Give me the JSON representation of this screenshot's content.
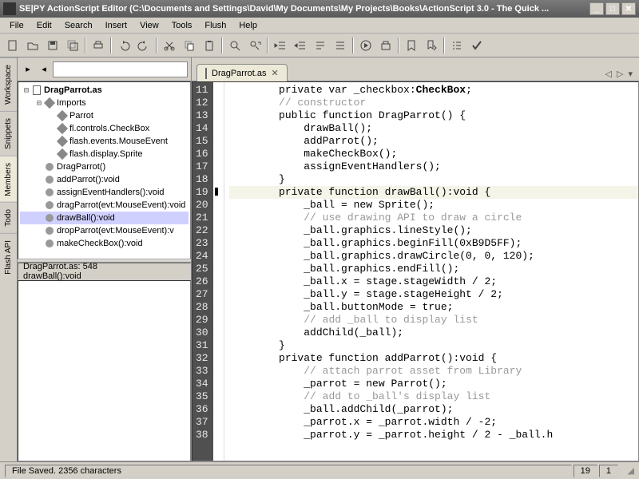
{
  "window": {
    "title": "SE|PY ActionScript Editor (C:\\Documents and Settings\\David\\My Documents\\My Projects\\Books\\ActionScript 3.0 - The Quick ..."
  },
  "menu": [
    "File",
    "Edit",
    "Search",
    "Insert",
    "View",
    "Tools",
    "Flush",
    "Help"
  ],
  "sidetabs": [
    "Workspace",
    "Snippets",
    "Members",
    "Todo",
    "Flash API"
  ],
  "tree": {
    "root": "DragParrot.as",
    "imports_label": "Imports",
    "imports": [
      "Parrot",
      "fl.controls.CheckBox",
      "flash.events.MouseEvent",
      "flash.display.Sprite"
    ],
    "members": [
      "DragParrot()",
      "addParrot():void",
      "assignEventHandlers():void",
      "dragParrot(evt:MouseEvent):void",
      "drawBall():void",
      "dropParrot(evt:MouseEvent):v",
      "makeCheckBox():void"
    ],
    "selected": "drawBall():void"
  },
  "location": {
    "line1": "DragParrot.as: 548",
    "line2": "drawBall():void"
  },
  "tab": {
    "label": "DragParrot.as"
  },
  "gutter_start": 11,
  "gutter_end": 38,
  "code_lines": [
    {
      "n": 11,
      "indent": 2,
      "segs": [
        {
          "t": "private var _checkbox:"
        },
        {
          "t": "CheckBox",
          "c": "ty"
        },
        {
          "t": ";"
        }
      ]
    },
    {
      "n": 12,
      "indent": 2,
      "segs": [
        {
          "t": "// constructor",
          "c": "cm"
        }
      ]
    },
    {
      "n": 13,
      "indent": 2,
      "segs": [
        {
          "t": "public function DragParrot() {"
        }
      ]
    },
    {
      "n": 14,
      "indent": 3,
      "segs": [
        {
          "t": "drawBall();"
        }
      ]
    },
    {
      "n": 15,
      "indent": 3,
      "segs": [
        {
          "t": "addParrot();"
        }
      ]
    },
    {
      "n": 16,
      "indent": 3,
      "segs": [
        {
          "t": "makeCheckBox();"
        }
      ]
    },
    {
      "n": 17,
      "indent": 3,
      "segs": [
        {
          "t": "assignEventHandlers();"
        }
      ]
    },
    {
      "n": 18,
      "indent": 2,
      "segs": [
        {
          "t": "}"
        }
      ]
    },
    {
      "n": 19,
      "indent": 2,
      "hl": true,
      "segs": [
        {
          "t": "private function drawBall():void {"
        }
      ]
    },
    {
      "n": 20,
      "indent": 3,
      "segs": [
        {
          "t": "_ball = new Sprite();"
        }
      ]
    },
    {
      "n": 21,
      "indent": 3,
      "segs": [
        {
          "t": "// use drawing API to draw a circle",
          "c": "cm"
        }
      ]
    },
    {
      "n": 22,
      "indent": 3,
      "segs": [
        {
          "t": "_ball.graphics.lineStyle();"
        }
      ]
    },
    {
      "n": 23,
      "indent": 3,
      "segs": [
        {
          "t": "_ball.graphics.beginFill(0xB9D5FF);"
        }
      ]
    },
    {
      "n": 24,
      "indent": 3,
      "segs": [
        {
          "t": "_ball.graphics.drawCircle(0, 0, 120);"
        }
      ]
    },
    {
      "n": 25,
      "indent": 3,
      "segs": [
        {
          "t": "_ball.graphics.endFill();"
        }
      ]
    },
    {
      "n": 26,
      "indent": 3,
      "segs": [
        {
          "t": "_ball.x = stage.stageWidth / 2;"
        }
      ]
    },
    {
      "n": 27,
      "indent": 3,
      "segs": [
        {
          "t": "_ball.y = stage.stageHeight / 2;"
        }
      ]
    },
    {
      "n": 28,
      "indent": 3,
      "segs": [
        {
          "t": "_ball.buttonMode = true;"
        }
      ]
    },
    {
      "n": 29,
      "indent": 3,
      "segs": [
        {
          "t": "// add _ball to display list",
          "c": "cm"
        }
      ]
    },
    {
      "n": 30,
      "indent": 3,
      "segs": [
        {
          "t": "addChild(_ball);"
        }
      ]
    },
    {
      "n": 31,
      "indent": 2,
      "segs": [
        {
          "t": "}"
        }
      ]
    },
    {
      "n": 32,
      "indent": 2,
      "segs": [
        {
          "t": "private function addParrot():void {"
        }
      ]
    },
    {
      "n": 33,
      "indent": 3,
      "segs": [
        {
          "t": "// attach parrot asset from Library",
          "c": "cm"
        }
      ]
    },
    {
      "n": 34,
      "indent": 3,
      "segs": [
        {
          "t": "_parrot = new Parrot();"
        }
      ]
    },
    {
      "n": 35,
      "indent": 3,
      "segs": [
        {
          "t": "// add to _ball's display list",
          "c": "cm"
        }
      ]
    },
    {
      "n": 36,
      "indent": 3,
      "segs": [
        {
          "t": "_ball.addChild(_parrot);"
        }
      ]
    },
    {
      "n": 37,
      "indent": 3,
      "segs": [
        {
          "t": "_parrot.x = _parrot.width / -2;"
        }
      ]
    },
    {
      "n": 38,
      "indent": 3,
      "segs": [
        {
          "t": "_parrot.y = _parrot.height / 2 - _ball.h"
        }
      ]
    }
  ],
  "status": {
    "message": "File Saved. 2356 characters",
    "line": "19",
    "col": "1"
  }
}
